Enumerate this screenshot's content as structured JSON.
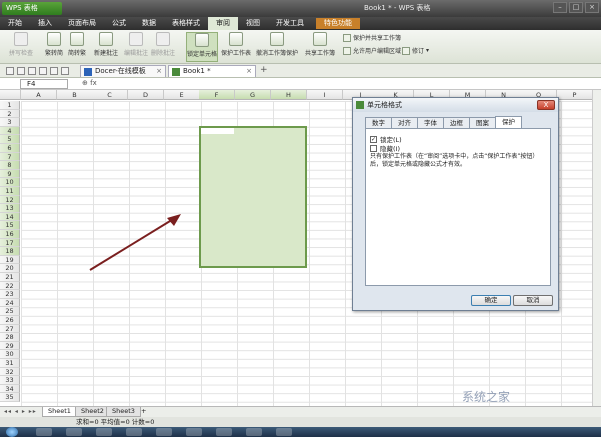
{
  "app": {
    "name": "WPS 表格",
    "window_title": "Book1 * - WPS 表格"
  },
  "menu": [
    "开始",
    "插入",
    "页面布局",
    "公式",
    "数据",
    "表格样式",
    "审阅",
    "视图",
    "开发工具"
  ],
  "menu_active_index": 6,
  "menu_special": "特色功能",
  "ribbon": {
    "buttons": [
      {
        "label": "拼写检查",
        "disabled": true
      },
      {
        "label": "繁转简",
        "disabled": false
      },
      {
        "label": "简转繁",
        "disabled": false
      },
      {
        "label": "新建批注",
        "disabled": false
      },
      {
        "label": "编辑批注",
        "disabled": true
      },
      {
        "label": "删除批注",
        "disabled": true
      },
      {
        "label": "锁定单元格",
        "disabled": false,
        "selected": true
      },
      {
        "label": "保护工作表",
        "disabled": false
      },
      {
        "label": "撤消工作簿保护",
        "disabled": false
      },
      {
        "label": "共享工作簿",
        "disabled": false
      }
    ],
    "side_items": [
      "保护并共享工作簿",
      "允许用户编辑区域",
      "修订"
    ]
  },
  "doc_tabs": [
    {
      "label": "Docer-在线模板",
      "active": false
    },
    {
      "label": "Book1 *",
      "active": true
    }
  ],
  "formula_bar": {
    "cell_ref": "F4",
    "fx": "fx"
  },
  "columns": [
    "A",
    "B",
    "C",
    "D",
    "E",
    "F",
    "G",
    "H",
    "I",
    "J",
    "K",
    "L",
    "M",
    "N",
    "O",
    "P"
  ],
  "highlighted_columns": [
    "F",
    "G",
    "H"
  ],
  "rows": [
    "1",
    "2",
    "3",
    "4",
    "5",
    "6",
    "7",
    "8",
    "9",
    "10",
    "11",
    "12",
    "13",
    "14",
    "15",
    "16",
    "17",
    "18",
    "19",
    "20",
    "21",
    "22",
    "23",
    "24",
    "25",
    "26",
    "27",
    "28",
    "29",
    "30",
    "31",
    "32",
    "33",
    "34",
    "35"
  ],
  "highlighted_rows": [
    "4",
    "5",
    "6",
    "7",
    "8",
    "9",
    "10",
    "11",
    "12",
    "13",
    "14",
    "15",
    "16",
    "17",
    "18"
  ],
  "sheet_tabs": [
    {
      "label": "Sheet1",
      "active": true
    },
    {
      "label": "Sheet2",
      "active": false
    },
    {
      "label": "Sheet3",
      "active": false
    }
  ],
  "status": "求和=0  平均值=0  计数=0",
  "dialog": {
    "title": "单元格格式",
    "close": "X",
    "tabs": [
      "数字",
      "对齐",
      "字体",
      "边框",
      "图案",
      "保护"
    ],
    "active_tab_index": 5,
    "locked_label": "锁定(L)",
    "locked_checked": true,
    "hidden_label": "隐藏(I)",
    "hidden_checked": false,
    "note": "只有保护工作表（在“审阅”选项卡中，点击“保护工作表”按钮）后，锁定单元格或隐藏公式才有效。",
    "ok": "确定",
    "cancel": "取消"
  },
  "watermark": "系统之家"
}
